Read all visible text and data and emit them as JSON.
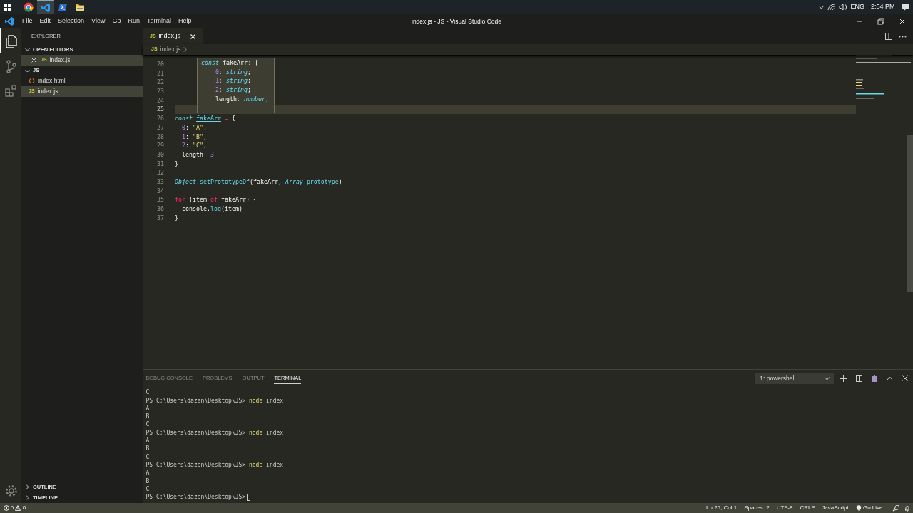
{
  "taskbar": {
    "apps": [
      {
        "kind": "browser",
        "selected": false
      },
      {
        "kind": "code-editor",
        "selected": true
      },
      {
        "kind": "terminal",
        "selected": false
      },
      {
        "kind": "folder",
        "selected": false
      }
    ],
    "language": "ENG",
    "time": "2:04 PM"
  },
  "titlebar": {
    "menu": [
      "File",
      "Edit",
      "Selection",
      "View",
      "Go",
      "Run",
      "Terminal",
      "Help"
    ],
    "title": "index.js - JS - Visual Studio Code"
  },
  "activity_bar": [
    {
      "kind": "explorer",
      "selected": true
    },
    {
      "kind": "source-control",
      "selected": false
    },
    {
      "kind": "extensions",
      "selected": false
    },
    {
      "kind": "settings",
      "selected": false
    }
  ],
  "sidebar": {
    "title": "EXPLORER",
    "sections": [
      {
        "label": "OPEN EDITORS",
        "expanded": true,
        "items": [
          {
            "label": "index.js",
            "kind": "js",
            "badge": "JS",
            "closable": true,
            "selected": true
          }
        ]
      },
      {
        "label": "JS",
        "expanded": true,
        "items": [
          {
            "label": "index.html",
            "kind": "html",
            "closable": false,
            "selected": false
          },
          {
            "label": "index.js",
            "kind": "js",
            "badge": "JS",
            "closable": false,
            "selected": true
          }
        ]
      }
    ],
    "bottom_sections": [
      {
        "label": "OUTLINE",
        "expanded": false
      },
      {
        "label": "TIMELINE",
        "expanded": false
      }
    ]
  },
  "editor": {
    "tabs": [
      {
        "label": "index.js",
        "badge": "JS",
        "selected": true
      }
    ],
    "breadcrumb": {
      "badge": "JS",
      "file": "index.js",
      "more": "..."
    },
    "lines": [
      {
        "number": "20",
        "current": false
      },
      {
        "number": "21",
        "current": false
      },
      {
        "number": "22",
        "current": false
      },
      {
        "number": "23",
        "current": false
      },
      {
        "number": "24",
        "current": false
      },
      {
        "number": "25",
        "current": true
      },
      {
        "number": "26",
        "current": false,
        "tokens": [
          {
            "kind": "keyword",
            "text": "const"
          },
          {
            "kind": "link",
            "text": " fakeArr"
          },
          {
            "kind": "operator",
            "text": " ="
          },
          {
            "kind": "plain",
            "text": " {"
          }
        ]
      },
      {
        "number": "27",
        "current": false,
        "tokens": [
          {
            "kind": "number",
            "text": "  0"
          },
          {
            "kind": "plain",
            "text": ":"
          },
          {
            "kind": "string",
            "text": " \"A\""
          },
          {
            "kind": "plain",
            "text": ","
          }
        ]
      },
      {
        "number": "28",
        "current": false,
        "tokens": [
          {
            "kind": "number",
            "text": "  1"
          },
          {
            "kind": "plain",
            "text": ":"
          },
          {
            "kind": "string",
            "text": " \"B\""
          },
          {
            "kind": "plain",
            "text": ","
          }
        ]
      },
      {
        "number": "29",
        "current": false,
        "tokens": [
          {
            "kind": "number",
            "text": "  2"
          },
          {
            "kind": "plain",
            "text": ":"
          },
          {
            "kind": "string",
            "text": " \"C\""
          },
          {
            "kind": "plain",
            "text": ","
          }
        ]
      },
      {
        "number": "30",
        "current": false,
        "tokens": [
          {
            "kind": "plain",
            "text": "  length:"
          },
          {
            "kind": "number",
            "text": " 3"
          }
        ]
      },
      {
        "number": "31",
        "current": false,
        "tokens": [
          {
            "kind": "plain",
            "text": "}"
          }
        ]
      },
      {
        "number": "32",
        "current": false
      },
      {
        "number": "33",
        "current": false,
        "tokens": [
          {
            "kind": "class",
            "text": "Object"
          },
          {
            "kind": "plain",
            "text": "."
          },
          {
            "kind": "function",
            "text": "setPrototypeOf"
          },
          {
            "kind": "plain",
            "text": "(fakeArr,"
          },
          {
            "kind": "class",
            "text": " Array"
          },
          {
            "kind": "plain",
            "text": "."
          },
          {
            "kind": "function",
            "text": "prototype"
          },
          {
            "kind": "plain",
            "text": ")"
          }
        ]
      },
      {
        "number": "34",
        "current": false
      },
      {
        "number": "35",
        "current": false,
        "tokens": [
          {
            "kind": "storage",
            "text": "for"
          },
          {
            "kind": "plain",
            "text": " (item"
          },
          {
            "kind": "storage",
            "text": " of"
          },
          {
            "kind": "plain",
            "text": " fakeArr) {"
          }
        ]
      },
      {
        "number": "36",
        "current": false,
        "tokens": [
          {
            "kind": "plain",
            "text": "  console."
          },
          {
            "kind": "function",
            "text": "log"
          },
          {
            "kind": "plain",
            "text": "(item)"
          }
        ]
      },
      {
        "number": "37",
        "current": false,
        "tokens": [
          {
            "kind": "plain",
            "text": "}"
          }
        ]
      }
    ],
    "hover": [
      [
        {
          "kind": "keyword",
          "text": "const"
        },
        {
          "kind": "plain",
          "text": " fakeArr"
        },
        {
          "kind": "punct",
          "text": ":"
        },
        {
          "kind": "plain",
          "text": " {"
        }
      ],
      [
        {
          "kind": "number",
          "text": "    0"
        },
        {
          "kind": "punct",
          "text": ":"
        },
        {
          "kind": "type",
          "text": " string"
        },
        {
          "kind": "plain",
          "text": ";"
        }
      ],
      [
        {
          "kind": "number",
          "text": "    1"
        },
        {
          "kind": "punct",
          "text": ":"
        },
        {
          "kind": "type",
          "text": " string"
        },
        {
          "kind": "plain",
          "text": ";"
        }
      ],
      [
        {
          "kind": "number",
          "text": "    2"
        },
        {
          "kind": "punct",
          "text": ":"
        },
        {
          "kind": "type",
          "text": " string"
        },
        {
          "kind": "plain",
          "text": ";"
        }
      ],
      [
        {
          "kind": "plain",
          "text": "    length"
        },
        {
          "kind": "punct",
          "text": ":"
        },
        {
          "kind": "type",
          "text": " number"
        },
        {
          "kind": "plain",
          "text": ";"
        }
      ],
      [
        {
          "kind": "plain",
          "text": "}"
        }
      ]
    ]
  },
  "panel": {
    "tabs": [
      {
        "label": "DEBUG CONSOLE",
        "selected": false
      },
      {
        "label": "PROBLEMS",
        "selected": false
      },
      {
        "label": "OUTPUT",
        "selected": false
      },
      {
        "label": "TERMINAL",
        "selected": true
      }
    ],
    "terminal_select": "1: powershell",
    "terminal": [
      {
        "kind": "output",
        "text": "C"
      },
      {
        "kind": "prompt",
        "prompt": "PS C:\\Users\\dazen\\Desktop\\JS>",
        "command": "node",
        "args": "index",
        "cursor": false
      },
      {
        "kind": "output",
        "text": "A"
      },
      {
        "kind": "output",
        "text": "B"
      },
      {
        "kind": "output",
        "text": "C"
      },
      {
        "kind": "prompt",
        "prompt": "PS C:\\Users\\dazen\\Desktop\\JS>",
        "command": "node",
        "args": "index",
        "cursor": false
      },
      {
        "kind": "output",
        "text": "A"
      },
      {
        "kind": "output",
        "text": "B"
      },
      {
        "kind": "output",
        "text": "C"
      },
      {
        "kind": "prompt",
        "prompt": "PS C:\\Users\\dazen\\Desktop\\JS>",
        "command": "node",
        "args": "index",
        "cursor": false
      },
      {
        "kind": "output",
        "text": "A"
      },
      {
        "kind": "output",
        "text": "B"
      },
      {
        "kind": "output",
        "text": "C"
      },
      {
        "kind": "prompt",
        "prompt": "PS C:\\Users\\dazen\\Desktop\\JS>",
        "cursor": true
      }
    ]
  },
  "status_bar": {
    "errors": "0",
    "warnings": "0",
    "items": [
      "Ln 25, Col 1",
      "Spaces: 2",
      "UTF-8",
      "CRLF",
      "JavaScript"
    ],
    "go_live": "Go Live"
  }
}
